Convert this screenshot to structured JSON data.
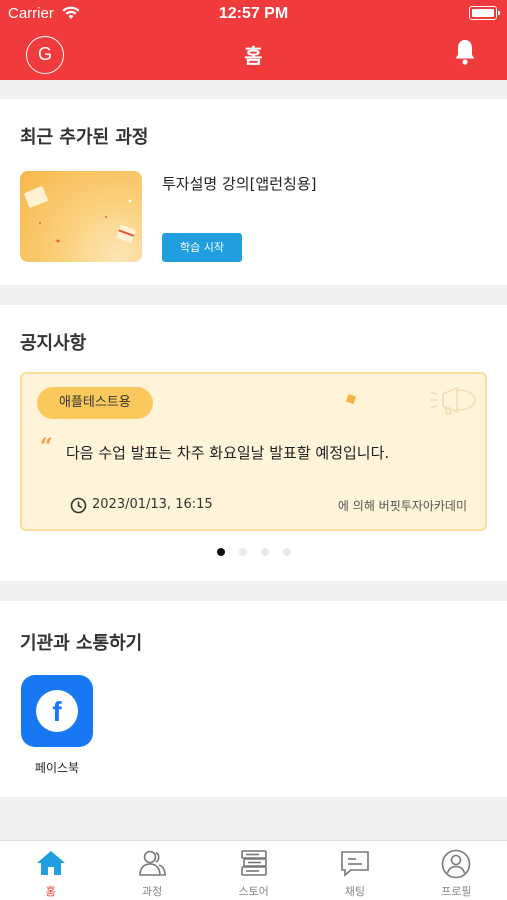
{
  "status_bar": {
    "carrier": "Carrier",
    "time": "12:57 PM"
  },
  "header": {
    "avatar_letter": "G",
    "title": "홈"
  },
  "recent": {
    "title": "최근 추가된 과정",
    "course_title": "투자설명 강의[앱런칭용]",
    "start_label": "학습 시작"
  },
  "notice": {
    "title": "공지사항",
    "tag": "애플테스트용",
    "quote": "“",
    "text": "다음 수업 발표는 차주 화요일날 발표할 예정입니다.",
    "date": "2023/01/13, 16:15",
    "author": "에 의해 버핏투자아카데미",
    "page_count": 4,
    "active_page": 1
  },
  "communicate": {
    "title": "기관과 소통하기",
    "facebook_glyph": "f",
    "facebook_label": "페이스북"
  },
  "tabs": [
    {
      "label": "홈",
      "icon": "home-icon",
      "active": true
    },
    {
      "label": "과정",
      "icon": "people-icon",
      "active": false
    },
    {
      "label": "스토어",
      "icon": "books-icon",
      "active": false
    },
    {
      "label": "채팅",
      "icon": "chat-icon",
      "active": false
    },
    {
      "label": "프로필",
      "icon": "profile-icon",
      "active": false
    }
  ],
  "colors": {
    "brand": "#f03a3c",
    "accent_blue": "#1f9ee0",
    "notice_bg": "#fff3d9",
    "tag_bg": "#fbc85c",
    "facebook": "#1877f2"
  }
}
